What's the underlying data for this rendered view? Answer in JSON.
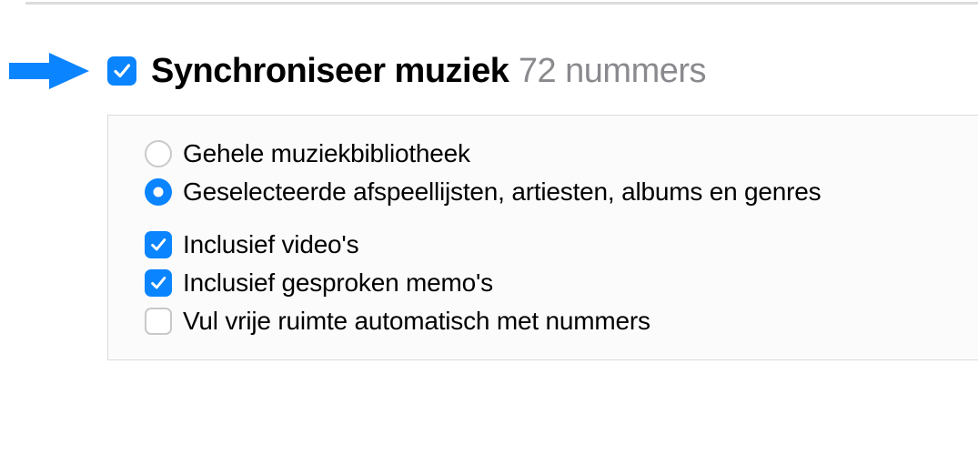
{
  "header": {
    "title": "Synchroniseer muziek",
    "count_label": "72 nummers",
    "sync_checked": true
  },
  "options": {
    "radio": {
      "entire_library": "Gehele muziekbibliotheek",
      "selected_items": "Geselecteerde afspeellijsten, artiesten, albums en genres",
      "selected": "selected_items"
    },
    "checkboxes": {
      "include_videos": {
        "label": "Inclusief video's",
        "checked": true
      },
      "include_voice_memos": {
        "label": "Inclusief gesproken memo's",
        "checked": true
      },
      "autofill": {
        "label": "Vul vrije ruimte automatisch met nummers",
        "checked": false
      }
    }
  }
}
